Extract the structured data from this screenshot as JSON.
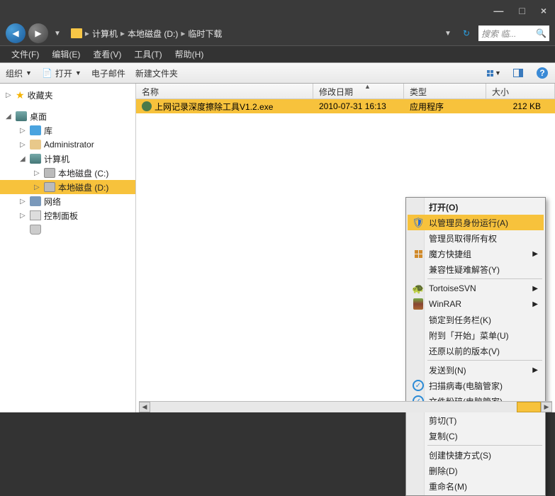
{
  "titlebar": {
    "min": "—",
    "max": "□",
    "close": "×"
  },
  "nav": {
    "breadcrumb": [
      "计算机",
      "本地磁盘 (D:)",
      "临时下载"
    ],
    "search_placeholder": "搜索 临..."
  },
  "menu": {
    "file": "文件(F)",
    "edit": "编辑(E)",
    "view": "查看(V)",
    "tools": "工具(T)",
    "help": "帮助(H)"
  },
  "toolbar": {
    "organize": "组织",
    "open": "打开",
    "email": "电子邮件",
    "newfolder": "新建文件夹"
  },
  "tree": {
    "favorites": "收藏夹",
    "desktop": "桌面",
    "libraries": "库",
    "admin": "Administrator",
    "computer": "计算机",
    "drive_c": "本地磁盘 (C:)",
    "drive_d": "本地磁盘 (D:)",
    "network": "网络",
    "control": "控制面板",
    "recycle": ""
  },
  "columns": {
    "name": "名称",
    "date": "修改日期",
    "type": "类型",
    "size": "大小"
  },
  "files": [
    {
      "name": "上网记录深度擦除工具V1.2.exe",
      "date": "2010-07-31 16:13",
      "type": "应用程序",
      "size": "212 KB"
    }
  ],
  "context": {
    "open": "打开(O)",
    "runas": "以管理员身份运行(A)",
    "takeown": "管理员取得所有权",
    "mofang": "魔方快捷组",
    "compat": "兼容性疑难解答(Y)",
    "tortoise": "TortoiseSVN",
    "winrar": "WinRAR",
    "pin": "锁定到任务栏(K)",
    "startpin": "附到「开始」菜单(U)",
    "restore": "还原以前的版本(V)",
    "sendto": "发送到(N)",
    "scan": "扫描病毒(电脑管家)",
    "shred": "文件粉碎(电脑管家)",
    "cut": "剪切(T)",
    "copy": "复制(C)",
    "shortcut": "创建快捷方式(S)",
    "delete": "删除(D)",
    "rename": "重命名(M)"
  }
}
